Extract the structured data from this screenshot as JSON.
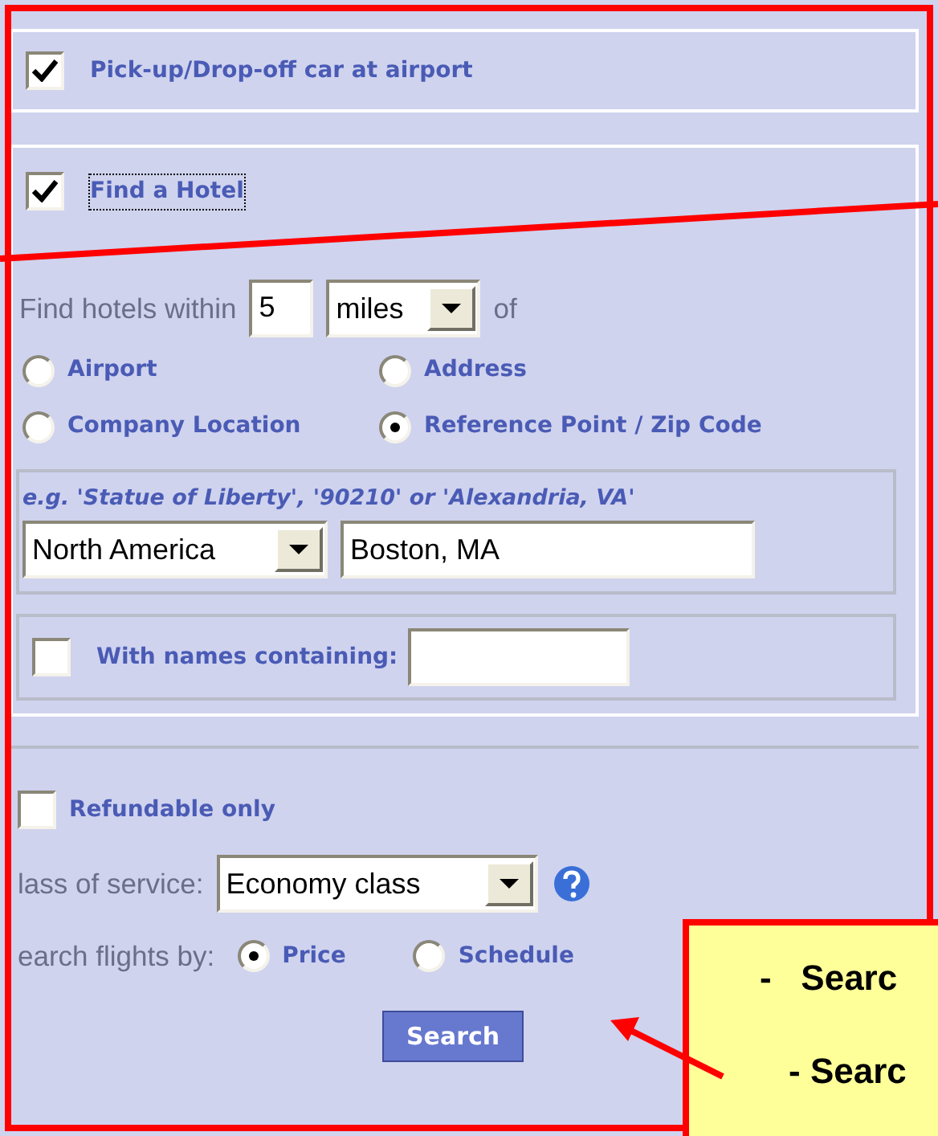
{
  "car_option": {
    "label": "Pick-up/Drop-off car at airport",
    "checked": true
  },
  "hotel": {
    "label": "Find a Hotel",
    "checked": true,
    "focused": true,
    "within": {
      "label": "Find hotels within",
      "distance": "5",
      "unit": "miles",
      "suffix": "of"
    },
    "locations": [
      {
        "label": "Airport",
        "selected": false
      },
      {
        "label": "Address",
        "selected": false
      },
      {
        "label": "Company Location",
        "selected": false
      },
      {
        "label": "Reference Point / Zip Code",
        "selected": true
      }
    ],
    "example": "e.g. 'Statue of Liberty', '90210' or 'Alexandria, VA'",
    "region": "North America",
    "place": "Boston, MA",
    "name_filter": {
      "label": "With names containing:",
      "checked": false
    }
  },
  "refundable": {
    "label": "Refundable only",
    "checked": false
  },
  "class_of_service": {
    "label": "lass of service:",
    "value": "Economy class"
  },
  "search_by": {
    "label": "earch flights by:",
    "options": [
      {
        "label": "Price",
        "selected": true
      },
      {
        "label": "Schedule",
        "selected": false
      }
    ]
  },
  "search_button": "Search",
  "callout": {
    "lines": [
      "-   Searc",
      "- Searc"
    ]
  }
}
